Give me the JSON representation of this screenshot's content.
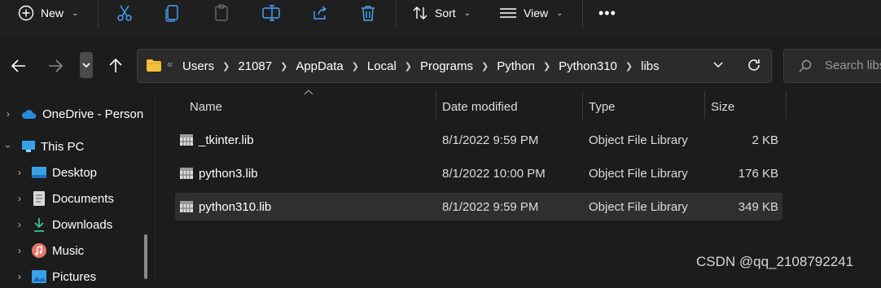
{
  "toolbar": {
    "new_label": "New",
    "sort_label": "Sort",
    "view_label": "View",
    "more_label": "•••"
  },
  "address_bar": {
    "crumbs": [
      "Users",
      "21087",
      "AppData",
      "Local",
      "Programs",
      "Python",
      "Python310",
      "libs"
    ],
    "overflow": "«"
  },
  "search": {
    "placeholder": "Search libs"
  },
  "sidebar": {
    "items": [
      {
        "label": "OneDrive - Person",
        "icon": "cloud-icon"
      },
      {
        "label": "This PC",
        "icon": "monitor-icon"
      },
      {
        "label": "Desktop",
        "icon": "desktop-icon"
      },
      {
        "label": "Documents",
        "icon": "document-icon"
      },
      {
        "label": "Downloads",
        "icon": "download-icon"
      },
      {
        "label": "Music",
        "icon": "music-icon"
      },
      {
        "label": "Pictures",
        "icon": "picture-icon"
      }
    ]
  },
  "columns": {
    "name": "Name",
    "date": "Date modified",
    "type": "Type",
    "size": "Size"
  },
  "files": [
    {
      "name": "_tkinter.lib",
      "date": "8/1/2022 9:59 PM",
      "type": "Object File Library",
      "size": "2 KB"
    },
    {
      "name": "python3.lib",
      "date": "8/1/2022 10:00 PM",
      "type": "Object File Library",
      "size": "176 KB"
    },
    {
      "name": "python310.lib",
      "date": "8/1/2022 9:59 PM",
      "type": "Object File Library",
      "size": "349 KB"
    }
  ],
  "watermark": "CSDN @qq_2108792241",
  "colors": {
    "background": "#1c1c1c",
    "accent": "#4aa3ff",
    "folder": "#f3c13a"
  }
}
